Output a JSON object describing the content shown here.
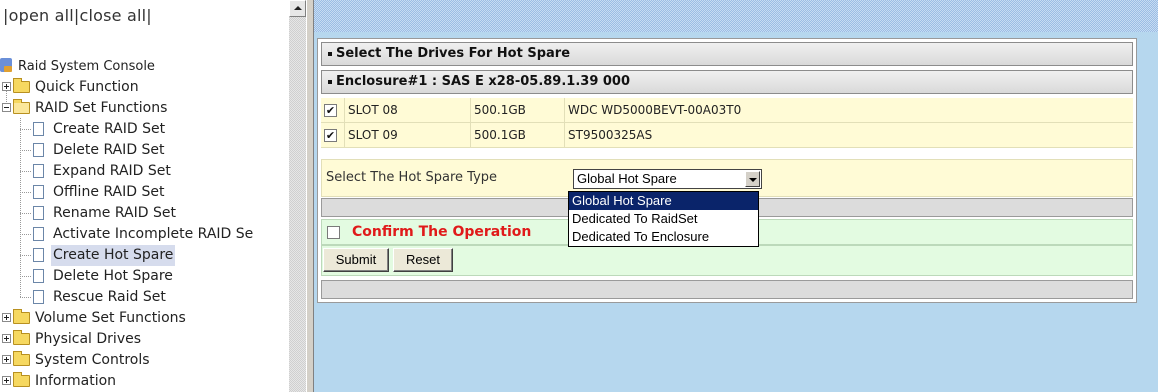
{
  "nav": {
    "toggle": {
      "sep1": "|",
      "open_all": "open all",
      "sep2": "|",
      "close_all": "close all",
      "sep3": "|"
    },
    "root": "Raid System Console",
    "items": [
      {
        "label": "Quick Function",
        "type": "folder",
        "expanded": false
      },
      {
        "label": "RAID Set Functions",
        "type": "folder",
        "expanded": true
      },
      {
        "label": "Create RAID Set",
        "type": "page"
      },
      {
        "label": "Delete RAID Set",
        "type": "page"
      },
      {
        "label": "Expand RAID Set",
        "type": "page"
      },
      {
        "label": "Offline RAID Set",
        "type": "page"
      },
      {
        "label": "Rename RAID Set",
        "type": "page"
      },
      {
        "label": "Activate Incomplete RAID Se",
        "type": "page"
      },
      {
        "label": "Create Hot Spare",
        "type": "page",
        "selected": true
      },
      {
        "label": "Delete Hot Spare",
        "type": "page"
      },
      {
        "label": "Rescue Raid Set",
        "type": "page"
      },
      {
        "label": "Volume Set Functions",
        "type": "folder",
        "expanded": false
      },
      {
        "label": "Physical Drives",
        "type": "folder",
        "expanded": false
      },
      {
        "label": "System Controls",
        "type": "folder",
        "expanded": false
      },
      {
        "label": "Information",
        "type": "folder",
        "expanded": false
      }
    ]
  },
  "main": {
    "section_title": "Select The Drives For Hot Spare",
    "enclosure": "Enclosure#1 : SAS E x28-05.89.1.39 000",
    "drives": [
      {
        "checked": true,
        "slot": "SLOT 08",
        "capacity": "500.1GB",
        "model": "WDC WD5000BEVT-00A03T0"
      },
      {
        "checked": true,
        "slot": "SLOT 09",
        "capacity": "500.1GB",
        "model": "ST9500325AS"
      }
    ],
    "checkmark": "✔",
    "hot_spare_label": "Select The Hot Spare Type",
    "hot_spare_value": "Global Hot Spare",
    "hot_spare_options": [
      "Global Hot Spare",
      "Dedicated To RaidSet",
      "Dedicated To Enclosure"
    ],
    "confirm_label": "Confirm The Operation",
    "confirm_checked": false,
    "submit_label": "Submit",
    "reset_label": "Reset"
  },
  "colors": {
    "header_bg": "#dcdcdc",
    "drive_row_bg": "#fffbd6",
    "confirm_bg": "#e3fbe1",
    "confirm_text": "#e01a1a",
    "content_bg": "#b6d7ee",
    "selection": "#0a246a"
  },
  "icons": [
    "raid-console-icon",
    "folder-icon",
    "folder-open-icon",
    "page-icon",
    "expand-plus-icon",
    "collapse-minus-icon",
    "checkbox-icon",
    "dropdown-arrow-icon",
    "scroll-up-arrow-icon"
  ]
}
